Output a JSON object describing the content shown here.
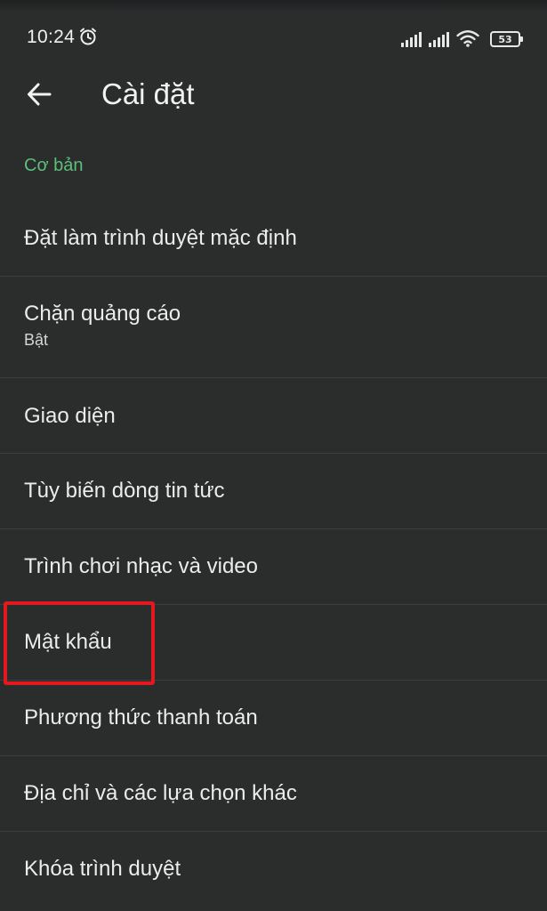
{
  "status_bar": {
    "time": "10:24",
    "battery": "53",
    "icons": [
      "alarm-icon",
      "signal-icon",
      "signal-icon",
      "wifi-icon",
      "battery-icon"
    ]
  },
  "app_bar": {
    "back_icon": "arrow-left-icon",
    "title": "Cài đặt"
  },
  "section": {
    "title": "Cơ bản"
  },
  "items": [
    {
      "label": "Đặt làm trình duyệt mặc định"
    },
    {
      "label": "Chặn quảng cáo",
      "sublabel": "Bật"
    },
    {
      "label": "Giao diện"
    },
    {
      "label": "Tùy biến dòng tin tức"
    },
    {
      "label": "Trình chơi nhạc và video"
    },
    {
      "label": "Mật khẩu",
      "highlighted": true
    },
    {
      "label": "Phương thức thanh toán"
    },
    {
      "label": "Địa chỉ và các lựa chọn khác"
    },
    {
      "label": "Khóa trình duyệt"
    }
  ],
  "colors": {
    "background": "#2b2c2c",
    "accent": "#5cbf7a",
    "highlight": "#e3191f",
    "text": "#ececec",
    "divider": "#3c3d3d"
  }
}
